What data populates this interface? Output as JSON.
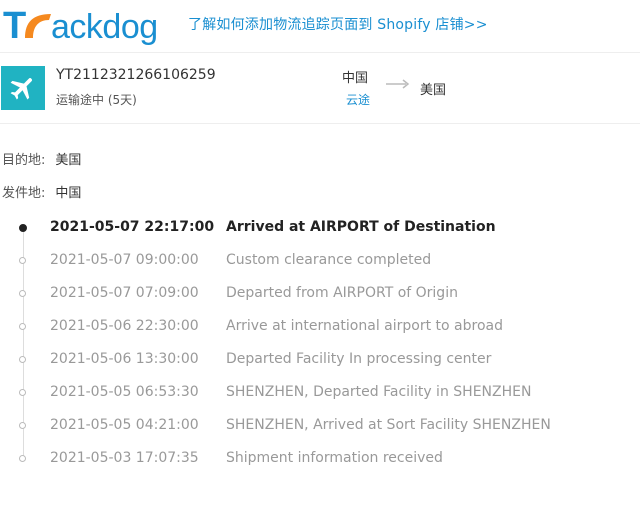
{
  "header": {
    "logo_text": "Trackdog",
    "promo_link": "了解如何添加物流追踪页面到 Shopify 店铺>>",
    "colors": {
      "logo_blue": "#1a8fd1",
      "logo_orange": "#f5891f"
    }
  },
  "shipment": {
    "carrier_icon": "airplane-icon",
    "tracking_number": "YT2112321266106259",
    "status": "运输途中 (5天)",
    "origin": "中国",
    "carrier": "云途",
    "destination": "美国"
  },
  "info": {
    "destination_label": "目的地:",
    "destination_value": "美国",
    "origin_label": "发件地:",
    "origin_value": "中国"
  },
  "events": [
    {
      "time": "2021-05-07 22:17:00",
      "desc": "Arrived at AIRPORT of Destination"
    },
    {
      "time": "2021-05-07 09:00:00",
      "desc": "Custom clearance completed"
    },
    {
      "time": "2021-05-07 07:09:00",
      "desc": "Departed from AIRPORT of Origin"
    },
    {
      "time": "2021-05-06 22:30:00",
      "desc": "Arrive at international airport to abroad"
    },
    {
      "time": "2021-05-06 13:30:00",
      "desc": "Departed Facility In processing center"
    },
    {
      "time": "2021-05-05 06:53:30",
      "desc": "SHENZHEN, Departed Facility in SHENZHEN"
    },
    {
      "time": "2021-05-05 04:21:00",
      "desc": "SHENZHEN, Arrived at Sort Facility SHENZHEN"
    },
    {
      "time": "2021-05-03 17:07:35",
      "desc": "Shipment information received"
    }
  ]
}
